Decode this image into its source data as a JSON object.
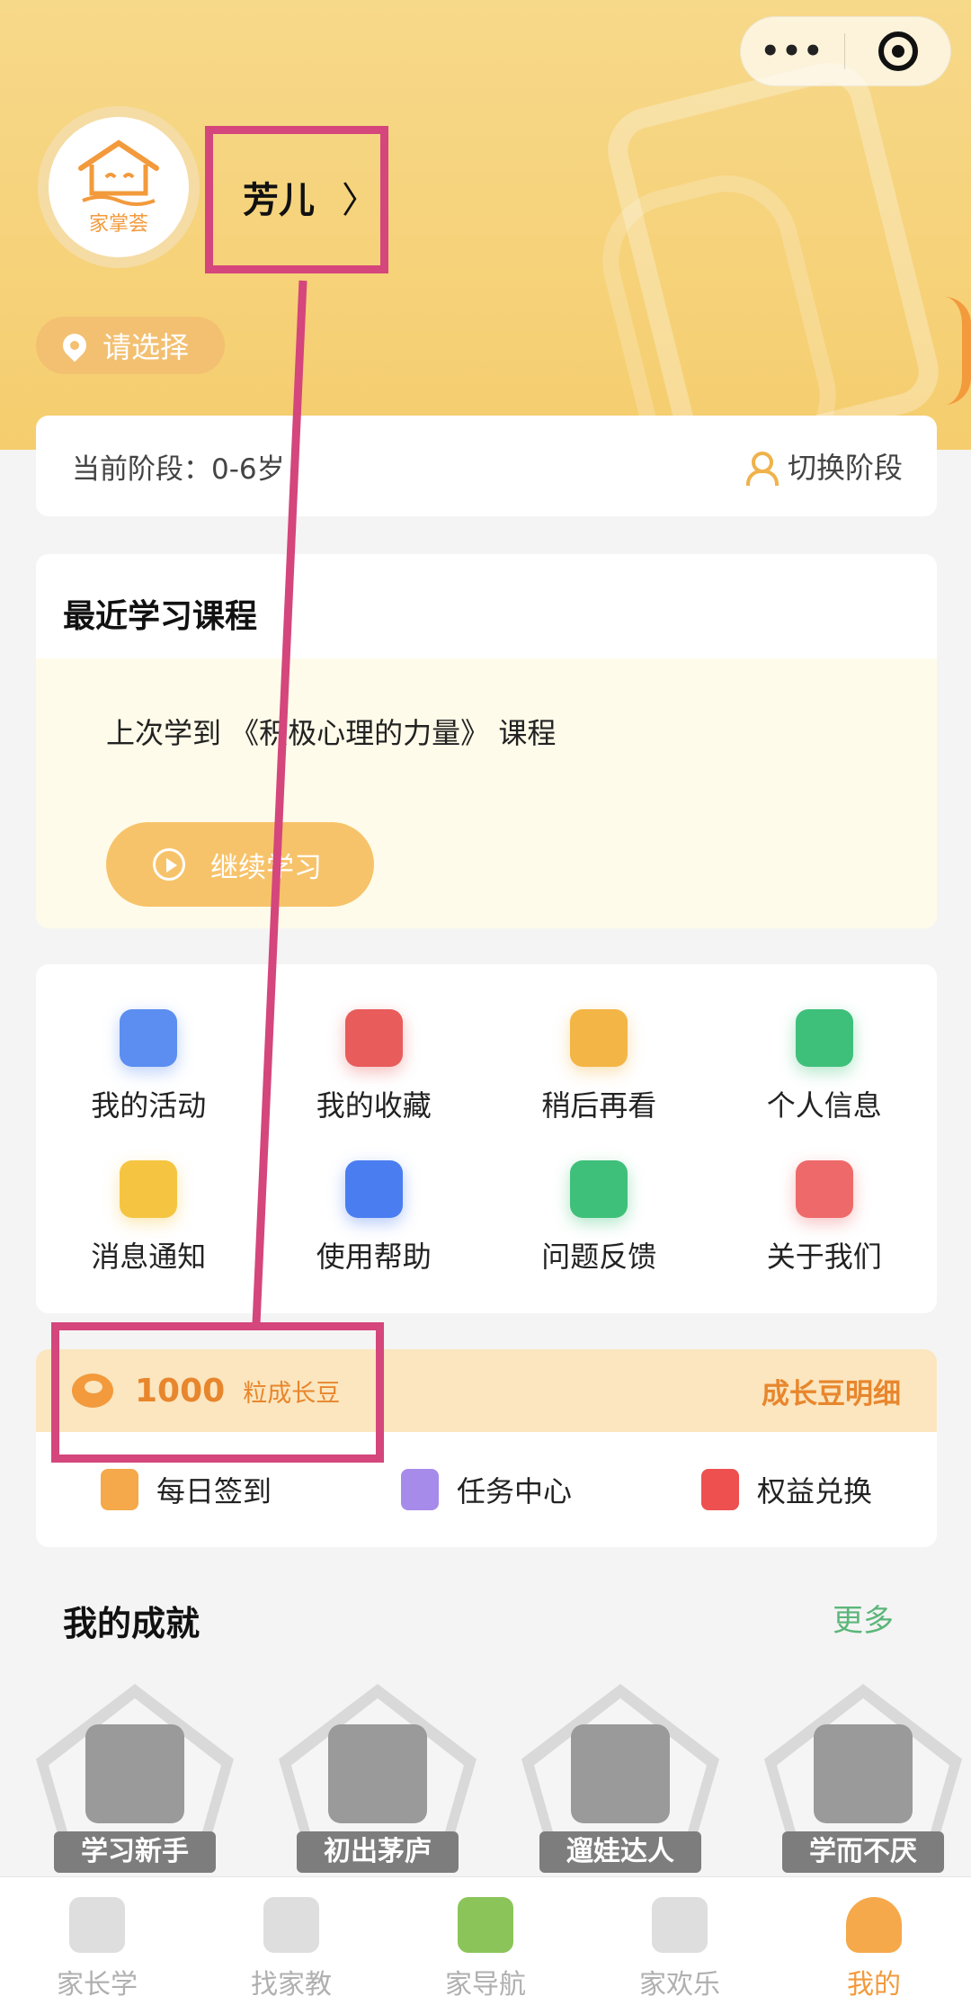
{
  "capsule": {
    "more_icon": "more-dots-icon",
    "close_icon": "target-icon",
    "more_label": "•••"
  },
  "profile": {
    "avatar_text": "家掌荟",
    "name": "芳儿",
    "arrow": "〉",
    "location": "请选择"
  },
  "stage": {
    "label": "当前阶段：0-6岁",
    "switch_label": "切换阶段"
  },
  "recent": {
    "title": "最近学习课程",
    "line": "上次学到 《积极心理的力量》 课程",
    "button": "继续学习"
  },
  "grid": [
    {
      "label": "我的活动",
      "icon": "calendar-icon",
      "color": "#5b8ef0"
    },
    {
      "label": "我的收藏",
      "icon": "heart-tag-icon",
      "color": "#e85c5c"
    },
    {
      "label": "稍后再看",
      "icon": "watch-later-icon",
      "color": "#f3b545"
    },
    {
      "label": "个人信息",
      "icon": "id-card-icon",
      "color": "#3fc07a"
    },
    {
      "label": "消息通知",
      "icon": "bell-icon",
      "color": "#f5c542"
    },
    {
      "label": "使用帮助",
      "icon": "help-doc-icon",
      "color": "#4a7ef0"
    },
    {
      "label": "问题反馈",
      "icon": "chat-bubble-icon",
      "color": "#3fc07a"
    },
    {
      "label": "关于我们",
      "icon": "user-card-icon",
      "color": "#ee6a6a"
    }
  ],
  "beans": {
    "count": "1000",
    "unit": "粒成长豆",
    "detail": "成长豆明细",
    "actions": [
      {
        "label": "每日签到",
        "icon": "clipboard-check-icon",
        "color": "#f5a94a"
      },
      {
        "label": "任务中心",
        "icon": "task-list-icon",
        "color": "#a78bea"
      },
      {
        "label": "权益兑换",
        "icon": "gift-icon",
        "color": "#ee5050"
      }
    ]
  },
  "achievements": {
    "title": "我的成就",
    "more": "更多",
    "badges": [
      "学习新手",
      "初出茅庐",
      "遛娃达人",
      "学而不厌"
    ]
  },
  "tabs": [
    {
      "label": "家长学",
      "icon": "graduation-cap-icon"
    },
    {
      "label": "找家教",
      "icon": "document-search-icon"
    },
    {
      "label": "家导航",
      "icon": "plant-hand-icon"
    },
    {
      "label": "家欢乐",
      "icon": "map-pin-icon"
    },
    {
      "label": "我的",
      "icon": "user-icon",
      "active": true
    }
  ],
  "colors": {
    "accent": "#f29a3c",
    "annotation": "#d4467c",
    "hero": "#f5cd6e",
    "more_green": "#5cb67a"
  }
}
